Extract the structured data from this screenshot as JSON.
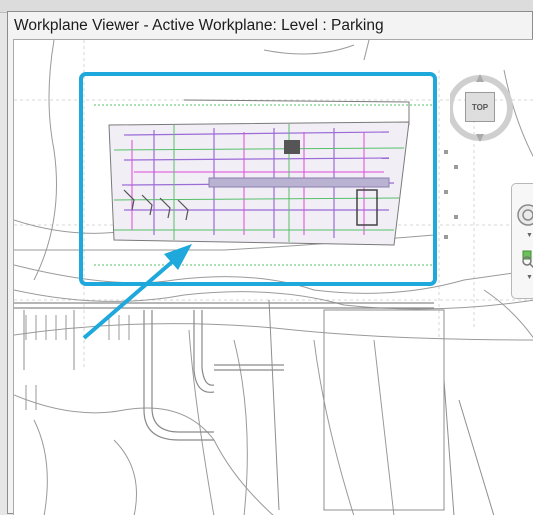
{
  "window": {
    "title": "Workplane Viewer - Active Workplane: Level : Parking"
  },
  "viewcube": {
    "face_label": "TOP"
  },
  "colors": {
    "highlight": "#1fa8dc",
    "arrow": "#1fa8dc",
    "plan_purple": "#9b6bd6",
    "plan_green": "#57c06a",
    "plan_magenta": "#e04ad8",
    "linework": "#9a9a9a"
  },
  "icons": [
    "close-icon",
    "steering-wheel-icon",
    "zoom-icon",
    "chevron-down-icon",
    "compass-ring-icon"
  ]
}
